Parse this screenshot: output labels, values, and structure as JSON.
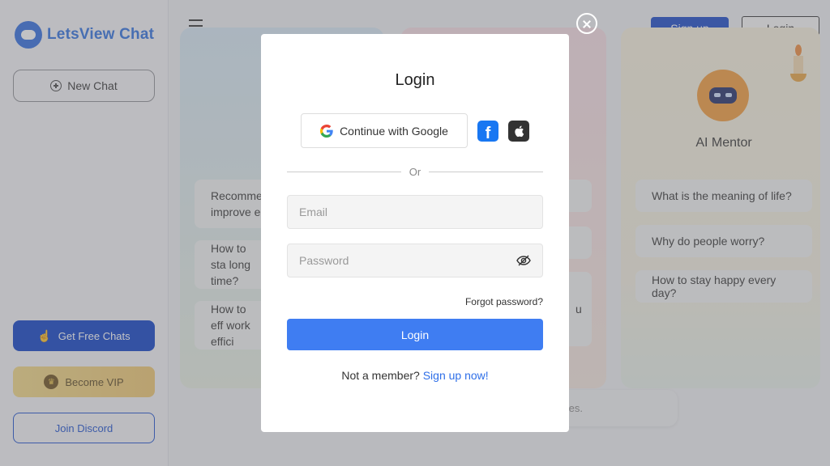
{
  "sidebar": {
    "logo_text": "LetsView Chat",
    "new_chat": "New Chat",
    "free_chats": "Get Free Chats",
    "vip": "Become VIP",
    "discord": "Join Discord"
  },
  "header": {
    "signup": "Sign up",
    "login": "Login"
  },
  "cards": {
    "left_questions": [
      "Recommen improve e",
      "How to sta long time?",
      "How to eff work effici"
    ],
    "mentor": {
      "name": "AI Mentor",
      "questions": [
        "What is the meaning of life?",
        "Why do people worry?",
        "How to stay happy every day?"
      ]
    },
    "middle_fragment": "u",
    "bottom_fragment": "tes."
  },
  "modal": {
    "title": "Login",
    "google_label": "Continue with Google",
    "divider": "Or",
    "email_placeholder": "Email",
    "password_placeholder": "Password",
    "forgot": "Forgot password?",
    "submit": "Login",
    "not_member": "Not a member?",
    "signup_link": "Sign up now!"
  },
  "colors": {
    "brand_blue": "#2b6fe0",
    "primary_button": "#3f7df2",
    "signup_button": "#1848c9"
  }
}
